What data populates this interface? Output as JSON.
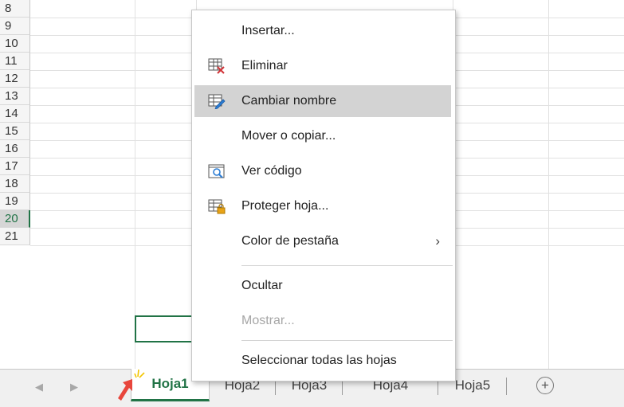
{
  "row_numbers": [
    "8",
    "9",
    "10",
    "11",
    "12",
    "13",
    "14",
    "15",
    "16",
    "17",
    "18",
    "19",
    "20",
    "21"
  ],
  "active_row": "20",
  "menu": {
    "insert": "Insertar...",
    "delete": "Eliminar",
    "rename": "Cambiar nombre",
    "move_copy": "Mover o copiar...",
    "view_code": "Ver código",
    "protect_sheet": "Proteger hoja...",
    "tab_color": "Color de pestaña",
    "hide": "Ocultar",
    "unhide": "Mostrar...",
    "select_all": "Seleccionar todas las hojas"
  },
  "sheet_tabs": [
    "Hoja1",
    "Hoja2",
    "Hoja3",
    "Hoja4",
    "Hoja5"
  ],
  "active_tab": "Hoja1",
  "colors": {
    "excel_green": "#217346",
    "highlight": "#d3d3d3",
    "pointer_red": "#e8463c"
  }
}
